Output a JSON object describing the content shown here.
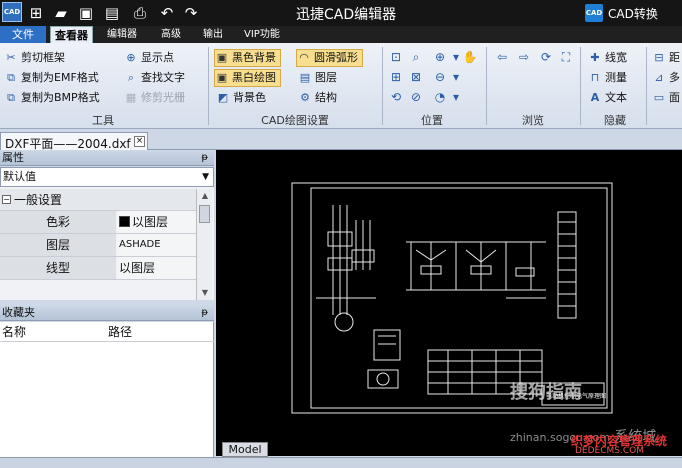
{
  "window": {
    "title": "迅捷CAD编辑器",
    "logo_text": "CAD",
    "convert_icon_text": "CAD",
    "convert_label": "CAD转换"
  },
  "quick_access": [
    "new-icon",
    "open-icon",
    "save-icon",
    "save-as-icon",
    "print-icon",
    "undo-icon",
    "redo-icon"
  ],
  "menu": {
    "file": "文件",
    "tabs": [
      "查看器",
      "编辑器",
      "高级",
      "输出",
      "VIP功能"
    ]
  },
  "ribbon": {
    "tools": {
      "label": "工具",
      "items": [
        "剪切框架",
        "复制为EMF格式",
        "复制为BMP格式",
        "显示点",
        "查找文字",
        "修剪光栅"
      ]
    },
    "cad_settings": {
      "label": "CAD绘图设置",
      "items": [
        "黑色背景",
        "黑白绘图",
        "背景色",
        "圆滑弧形",
        "图层",
        "结构"
      ]
    },
    "position": {
      "label": "位置"
    },
    "browse": {
      "label": "浏览"
    },
    "hide": {
      "label": "隐藏",
      "items": [
        "线宽",
        "测量",
        "文本"
      ]
    },
    "more": {
      "items": [
        "距",
        "多",
        "面"
      ]
    }
  },
  "document": {
    "tab_label": "DXF平面——2004.dxf",
    "close": "×"
  },
  "properties": {
    "title": "属性",
    "pin": "ᵽ",
    "dropdown_value": "默认值",
    "group": "一般设置",
    "group_toggle": "−",
    "rows": [
      {
        "key": "色彩",
        "value": "以图层"
      },
      {
        "key": "图层",
        "value": "ASHADE"
      },
      {
        "key": "线型",
        "value": "以图层"
      }
    ]
  },
  "favorites": {
    "title": "收藏夹",
    "pin": "ᵽ",
    "col_name": "名称",
    "col_path": "路径"
  },
  "drawing": {
    "model_tab": "Model",
    "table_title": "电动机控制电气原理图"
  },
  "watermarks": {
    "sogou": "搜狗指南",
    "site": "zhinan.sogou.com",
    "site2": "系统城",
    "dede": "织梦内容管理系统",
    "dede_url": "DEDECMS.COM"
  },
  "colors": {
    "accent": "#2e6fc6",
    "titlebar": "#151515",
    "canvas": "#000000",
    "highlight": "#f8df8f"
  }
}
